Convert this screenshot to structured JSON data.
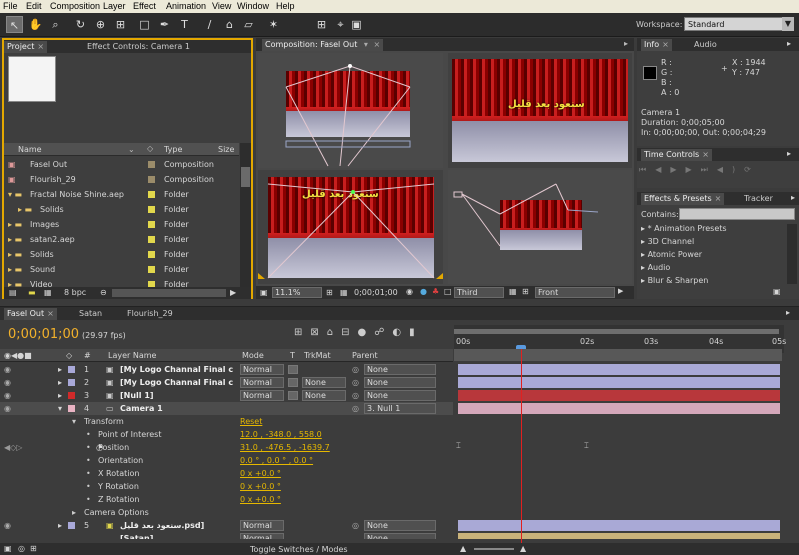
{
  "menu": [
    "File",
    "Edit",
    "Composition",
    "Layer",
    "Effect",
    "Animation",
    "View",
    "Window",
    "Help"
  ],
  "toolbar": {
    "workspace_label": "Workspace:",
    "workspace_value": "Standard"
  },
  "project_panel": {
    "tab_project": "Project",
    "tab_effect_controls": "Effect Controls: Camera 1",
    "columns": {
      "name": "Name",
      "type": "Type",
      "size": "Size"
    },
    "items": [
      {
        "name": "Fasel Out",
        "type": "Composition",
        "color": "#9b8c6a"
      },
      {
        "name": "Flourish_29",
        "type": "Composition",
        "color": "#9b8c6a"
      },
      {
        "name": "Fractal Noise Shine.aep",
        "type": "Folder",
        "color": "#e2d84c"
      },
      {
        "name": "Solids",
        "type": "Folder",
        "color": "#e2d84c"
      },
      {
        "name": "Images",
        "type": "Folder",
        "color": "#e2d84c"
      },
      {
        "name": "satan2.aep",
        "type": "Folder",
        "color": "#e2d84c"
      },
      {
        "name": "Solids",
        "type": "Folder",
        "color": "#e2d84c"
      },
      {
        "name": "Sound",
        "type": "Folder",
        "color": "#e2d84c"
      },
      {
        "name": "Video",
        "type": "Folder",
        "color": "#e2d84c"
      }
    ],
    "bpc": "8 bpc"
  },
  "composition_panel": {
    "tab": "Composition: Fasel Out",
    "zoom": "11.1%",
    "timecode": "0;00;01;00",
    "view_mode": "Third",
    "view_front": "Front",
    "arabic_text": "ﺳﻨﻌﻮﺩ ﺑﻌﺪ ﻗﻠﻴﻞ"
  },
  "info_panel": {
    "tab_info": "Info",
    "tab_audio": "Audio",
    "r": "R :",
    "g": "G :",
    "b": "B :",
    "a": "A : 0",
    "x": "X : 1944",
    "y": "Y : 747",
    "name": "Camera 1",
    "duration": "Duration: 0;00;05;00",
    "inout": "In: 0;00;00;00, Out: 0;00;04;29"
  },
  "time_controls": {
    "tab": "Time Controls"
  },
  "effects_panel": {
    "tab_effects": "Effects & Presets",
    "tab_tracker": "Tracker",
    "contains_label": "Contains:",
    "items": [
      "* Animation Presets",
      "3D Channel",
      "Atomic Power",
      "Audio",
      "Blur & Sharpen"
    ]
  },
  "timeline": {
    "tabs": [
      "Fasel Out",
      "Satan",
      "Flourish_29"
    ],
    "timecode": "0;00;01;00",
    "fps": "(29.97 fps)",
    "columns": {
      "num": "#",
      "layer_name": "Layer Name",
      "mode": "Mode",
      "t": "T",
      "trkmat": "TrkMat",
      "parent": "Parent"
    },
    "ruler": [
      "00s",
      "02s",
      "03s",
      "04s",
      "05s"
    ],
    "layers": [
      {
        "num": "1",
        "name": "[My Logo Channal Final c",
        "mode": "Normal",
        "trkmat": "",
        "parent": "None",
        "color": "#a8a8d8",
        "bar": "#a9a9d6"
      },
      {
        "num": "2",
        "name": "[My Logo Channal Final c",
        "mode": "Normal",
        "trkmat": "None",
        "parent": "None",
        "color": "#a8a8d8",
        "bar": "#a9a9d6"
      },
      {
        "num": "3",
        "name": "[Null 1]",
        "mode": "Normal",
        "trkmat": "None",
        "parent": "None",
        "color": "#d02a2a",
        "bar": "#b8373b"
      },
      {
        "num": "4",
        "name": "Camera 1",
        "mode": "",
        "trkmat": "",
        "parent": "3. Null 1",
        "color": "#e9b3c3",
        "bar": "#d4a7ba"
      }
    ],
    "props": [
      {
        "name": "Transform",
        "value": "Reset"
      },
      {
        "name": "Point of Interest",
        "value": "12.0 , -348.0 , 558.0"
      },
      {
        "name": "Position",
        "value": "31.0 , -476.5 , -1639.7"
      },
      {
        "name": "Orientation",
        "value": "0.0 ° , 0.0 ° , 0.0 °"
      },
      {
        "name": "X Rotation",
        "value": "0 x +0.0 °"
      },
      {
        "name": "Y Rotation",
        "value": "0 x +0.0 °"
      },
      {
        "name": "Z Rotation",
        "value": "0 x +0.0 °"
      },
      {
        "name": "Camera Options",
        "value": ""
      }
    ],
    "layer5": {
      "num": "5",
      "name": "ﺳﻨﻌﻮﺩ ﺑﻌﺪ ﻗﻠﻴﻞ.psd]",
      "mode": "Normal",
      "parent": "None"
    },
    "layer6": {
      "name": "[Satan]",
      "mode": "Normal",
      "parent": "None"
    },
    "toggle_label": "Toggle Switches / Modes"
  },
  "colors": {
    "accent": "#e3a800",
    "playhead": "#e22020",
    "timecode": "#f2b12b"
  }
}
